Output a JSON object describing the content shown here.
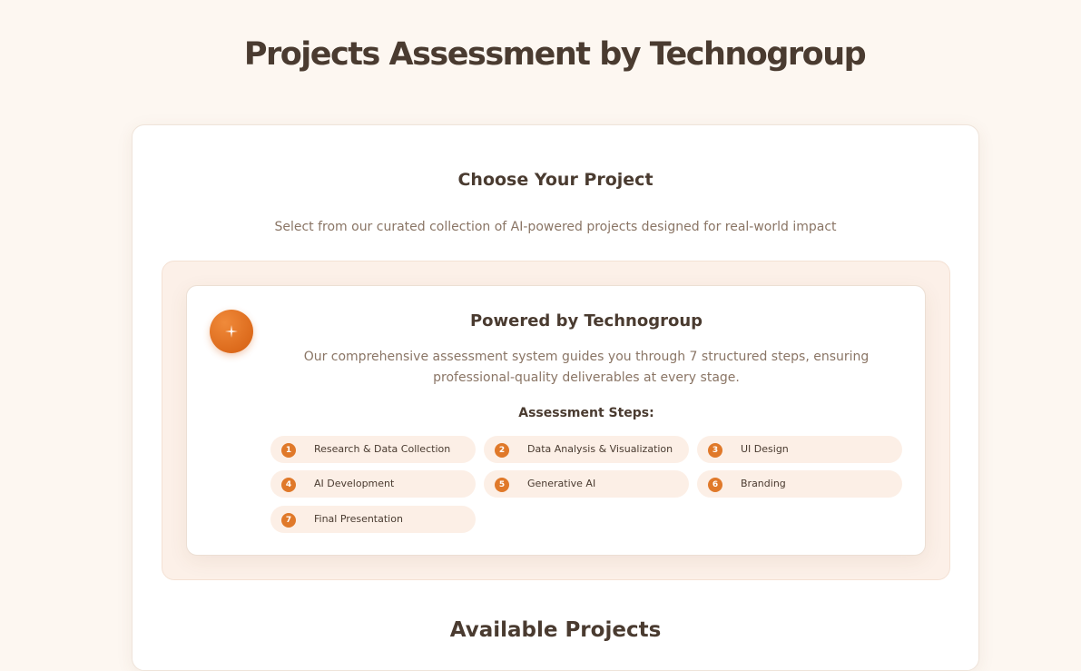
{
  "page": {
    "title": "Projects Assessment by Technogroup"
  },
  "chooser": {
    "title": "Choose Your Project",
    "subtitle": "Select from our curated collection of AI-powered projects designed for real-world impact"
  },
  "feature": {
    "icon": "sparkle-icon",
    "title": "Powered by Technogroup",
    "description": "Our comprehensive assessment system guides you through 7 structured steps, ensuring professional-quality deliverables at every stage.",
    "steps_heading": "Assessment Steps:",
    "steps": [
      {
        "num": "1",
        "label": "Research & Data Collection"
      },
      {
        "num": "2",
        "label": "Data Analysis & Visualization"
      },
      {
        "num": "3",
        "label": "UI Design"
      },
      {
        "num": "4",
        "label": "AI Development"
      },
      {
        "num": "5",
        "label": "Generative AI"
      },
      {
        "num": "6",
        "label": "Branding"
      },
      {
        "num": "7",
        "label": "Final Presentation"
      }
    ]
  },
  "available": {
    "title": "Available Projects"
  },
  "colors": {
    "accent": "#e0792a",
    "background": "#fdf7f1",
    "text": "#4a3b30",
    "muted_text": "#8a7565"
  }
}
